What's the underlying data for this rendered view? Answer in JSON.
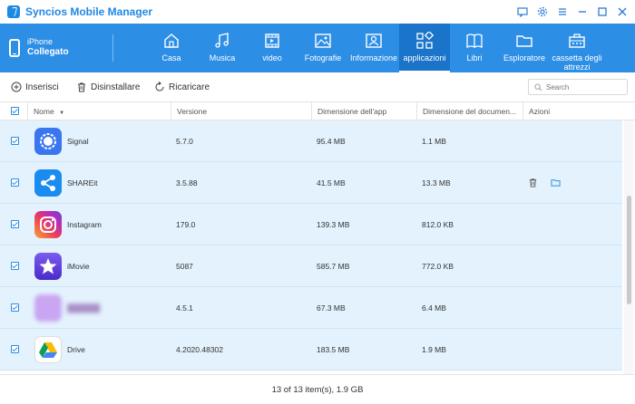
{
  "window": {
    "title": "Syncios Mobile Manager",
    "controls": [
      "feedback-icon",
      "gear-icon",
      "menu-icon",
      "minimize-icon",
      "maximize-icon",
      "close-icon"
    ]
  },
  "device": {
    "name": "iPhone",
    "status": "Collegato"
  },
  "nav": {
    "tabs": [
      {
        "label": "Casa",
        "icon": "home-icon"
      },
      {
        "label": "Musica",
        "icon": "music-icon"
      },
      {
        "label": "video",
        "icon": "video-icon"
      },
      {
        "label": "Fotografie",
        "icon": "photo-icon"
      },
      {
        "label": "Informazione",
        "icon": "contact-card-icon"
      },
      {
        "label": "applicazioni",
        "icon": "apps-icon",
        "active": true
      },
      {
        "label": "Libri",
        "icon": "book-icon"
      },
      {
        "label": "Esploratore",
        "icon": "folder-icon"
      },
      {
        "label": "cassetta degli attrezzi",
        "icon": "toolbox-icon"
      }
    ]
  },
  "toolbar": {
    "add_label": "Inserisci",
    "uninstall_label": "Disinstallare",
    "reload_label": "Ricaricare",
    "search_placeholder": "Search"
  },
  "table": {
    "columns": [
      "Nome",
      "Versione",
      "Dimensione dell'app",
      "Dimensione del documen...",
      "Azioni"
    ],
    "rows": [
      {
        "name": "Signal",
        "version": "5.7.0",
        "app_size": "95.4 MB",
        "doc_size": "1.1 MB",
        "icon": "signal-icon"
      },
      {
        "name": "SHAREit",
        "version": "3.5.88",
        "app_size": "41.5 MB",
        "doc_size": "13.3 MB",
        "icon": "shareit-icon",
        "actions": [
          "trash-icon",
          "folder-icon"
        ]
      },
      {
        "name": "Instagram",
        "version": "179.0",
        "app_size": "139.3 MB",
        "doc_size": "812.0 KB",
        "icon": "instagram-icon"
      },
      {
        "name": "iMovie",
        "version": "5087",
        "app_size": "585.7 MB",
        "doc_size": "772.0 KB",
        "icon": "imovie-icon"
      },
      {
        "name": "",
        "version": "4.5.1",
        "app_size": "67.3 MB",
        "doc_size": "6.4 MB",
        "icon": "blurred-app-icon"
      },
      {
        "name": "Drive",
        "version": "4.2020.48302",
        "app_size": "183.5 MB",
        "doc_size": "1.9 MB",
        "icon": "drive-icon"
      }
    ]
  },
  "status": {
    "summary": "13 of 13 item(s), 1.9 GB"
  },
  "colors": {
    "accent": "#2d8ee6",
    "row_selected": "#e3f2fd",
    "title": "#1e88e5"
  }
}
